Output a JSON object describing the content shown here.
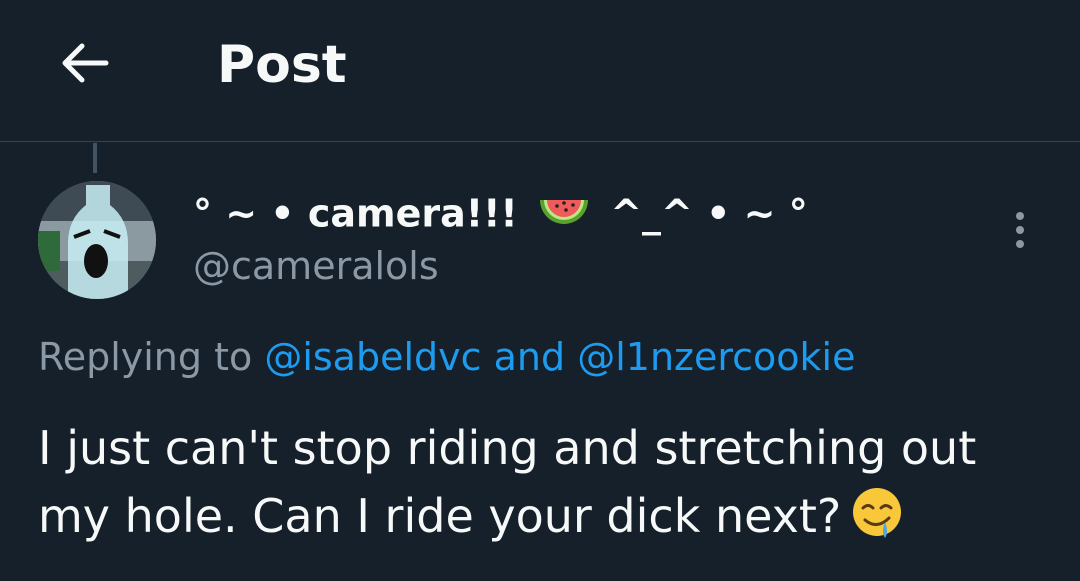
{
  "header": {
    "title": "Post",
    "back_icon": "arrow-left-icon"
  },
  "post": {
    "author": {
      "display_name_prefix": "° ~ • camera!!!",
      "display_name_suffix": "^_^ • ~ °",
      "name_emoji": "watermelon-icon",
      "handle": "@cameralols",
      "avatar": "bottle-character-avatar"
    },
    "more_icon": "more-vertical-icon",
    "replying_label": "Replying to",
    "mention_1": "@isabeldvc",
    "conjunction": "and",
    "mention_2": "@l1nzercookie",
    "text": "I just can't stop riding and stretching out my hole. Can I ride your dick next?",
    "text_emoji": "drooling-face-icon"
  },
  "colors": {
    "background": "#15202b",
    "text": "#f7f9f9",
    "secondary": "#8b98a5",
    "accent": "#1d9bf0",
    "divider": "#38444d"
  }
}
